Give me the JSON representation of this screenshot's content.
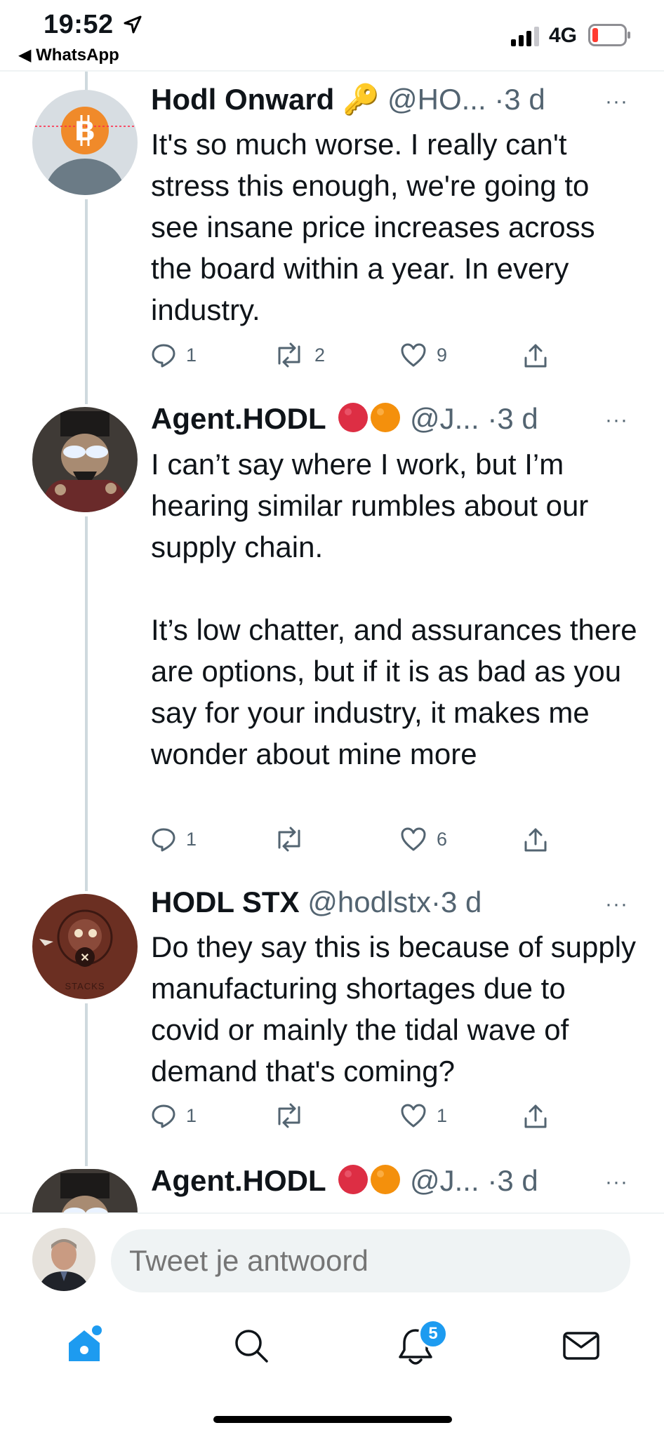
{
  "status_bar": {
    "time": "19:52",
    "back_app": "◀ WhatsApp",
    "network": "4G"
  },
  "tweets": [
    {
      "name": "Hodl Onward",
      "name_emoji": "🔑",
      "handle": "@HO...",
      "time": "·3 d",
      "more": "···",
      "text": "It's so much worse. I really can't stress this enough, we're going to see insane price increases across the board within a year. In every industry.",
      "replies": "1",
      "retweets": "2",
      "likes": "9"
    },
    {
      "name": "Agent.HODL",
      "handle": "@J...",
      "time": "·3 d",
      "more": "···",
      "text": "I can’t say where I work, but I’m hearing similar rumbles about our supply chain.\n\nIt’s low chatter, and assurances there are options, but if it is as bad as you say for your industry, it makes me wonder about mine more",
      "replies": "1",
      "retweets": "",
      "likes": "6"
    },
    {
      "name": "HODL STX",
      "handle": "@hodlstx",
      "time": "·3 d",
      "more": "···",
      "avatar_text": "STACKS",
      "text": "Do they say this is because of supply manufacturing shortages due to covid or mainly the tidal wave of demand that's coming?",
      "replies": "1",
      "retweets": "",
      "likes": "1"
    },
    {
      "name": "Agent.HODL",
      "handle": "@J...",
      "time": "·3 d",
      "more": "···"
    }
  ],
  "reply": {
    "placeholder": "Tweet je antwoord"
  },
  "tabbar": {
    "notifications_badge": "5"
  },
  "colors": {
    "accent": "#1d9bf0",
    "text": "#0f1419",
    "secondary": "#536471",
    "thread": "#cfd9de"
  }
}
